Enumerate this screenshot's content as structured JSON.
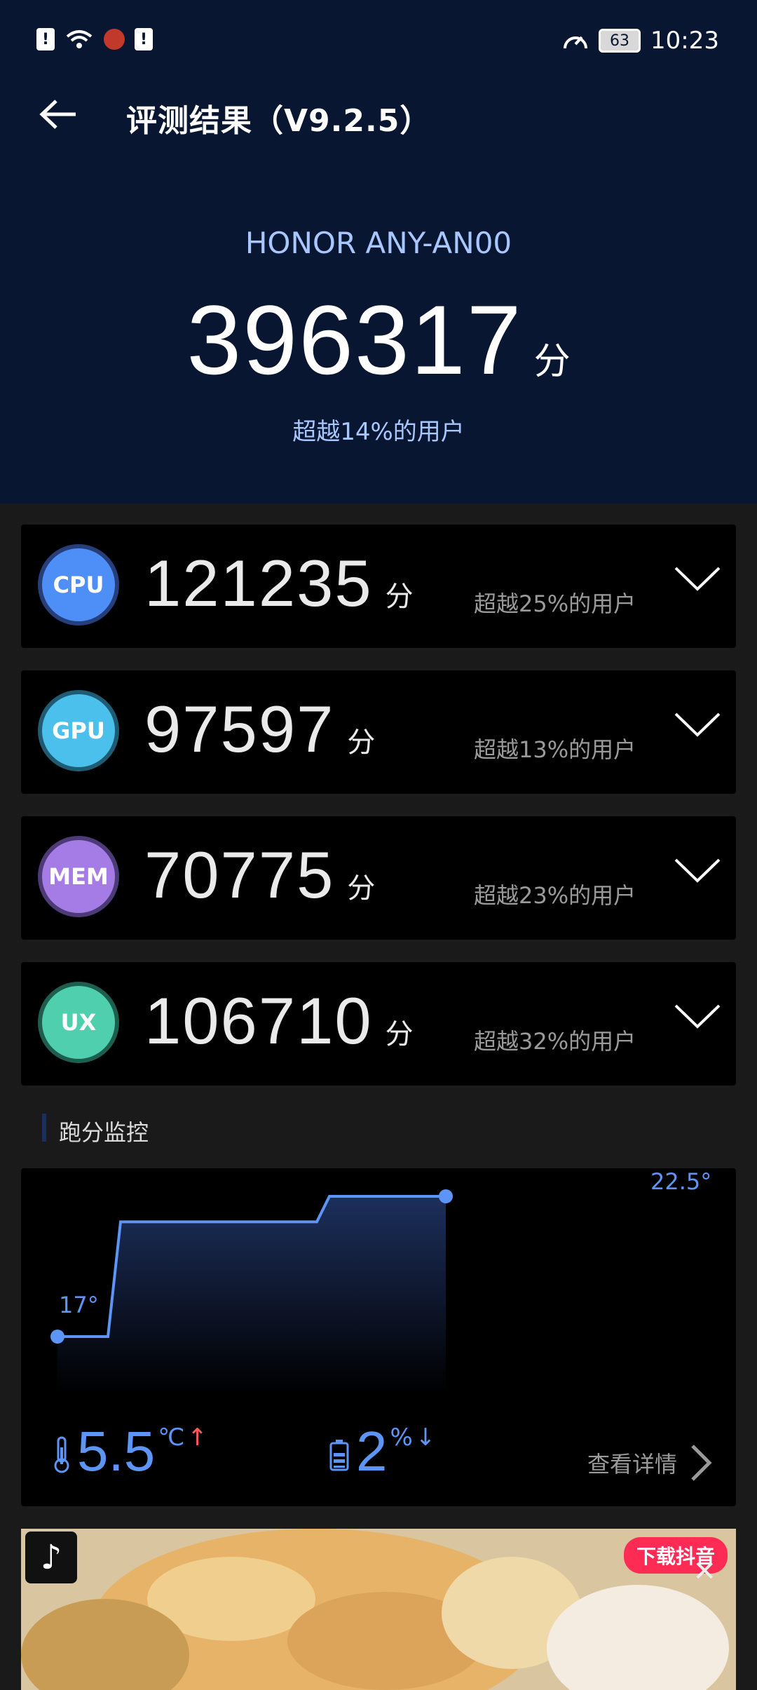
{
  "status_bar": {
    "battery_level": "63",
    "time": "10:23"
  },
  "app_bar": {
    "title": "评测结果（V9.2.5）"
  },
  "summary": {
    "device": "HONOR ANY-AN00",
    "total_score": "396317",
    "unit": "分",
    "exceed_text": "超越14%的用户"
  },
  "cards": [
    {
      "badge": "CPU",
      "score": "121235",
      "unit": "分",
      "exceed": "超越25%的用户"
    },
    {
      "badge": "GPU",
      "score": "97597",
      "unit": "分",
      "exceed": "超越13%的用户"
    },
    {
      "badge": "MEM",
      "score": "70775",
      "unit": "分",
      "exceed": "超越23%的用户"
    },
    {
      "badge": "UX",
      "score": "106710",
      "unit": "分",
      "exceed": "超越32%的用户"
    }
  ],
  "monitor": {
    "section_title": "跑分监控",
    "temp_start_label": "17°",
    "temp_end_label": "22.5°",
    "temperature_curve": [
      17,
      17,
      21.5,
      21.5,
      21.5,
      22.5,
      22.5
    ],
    "temp_change": "5.5",
    "temp_unit": "℃",
    "temp_arrow": "↑",
    "battery_change": "2",
    "battery_unit": "%",
    "battery_arrow": "↓",
    "details_label": "查看详情"
  },
  "ad": {
    "download_label": "下载抖音",
    "tiktok_glyph": "♪",
    "close_glyph": "✕"
  },
  "colors": {
    "header_bg": "#091631",
    "accent_blue": "#5c95f5",
    "cpu": "#4e8ef7",
    "gpu": "#4cc0ec",
    "mem": "#a57be6",
    "ux": "#50cfae"
  }
}
